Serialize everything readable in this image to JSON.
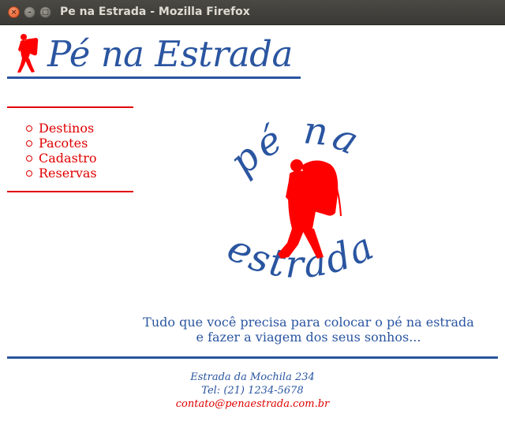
{
  "window": {
    "title": "Pe na Estrada - Mozilla Firefox",
    "close_glyph": "×",
    "minimize_glyph": "–",
    "maximize_glyph": "□"
  },
  "header": {
    "site_title": "Pé na Estrada"
  },
  "nav": {
    "items": [
      {
        "label": "Destinos"
      },
      {
        "label": "Pacotes"
      },
      {
        "label": "Cadastro"
      },
      {
        "label": "Reservas"
      }
    ]
  },
  "logo": {
    "top_text": "pé na",
    "bottom_text": "estrada"
  },
  "tagline": {
    "line1": "Tudo que você precisa para colocar o pé na estrada",
    "line2": "e fazer a viagem dos seus sonhos..."
  },
  "footer": {
    "address": "Estrada da Mochila 234",
    "phone": "Tel: (21) 1234-5678",
    "email": "contato@penaestrada.com.br"
  },
  "colors": {
    "brand_blue": "#2a55a0",
    "accent_red": "#e00000"
  }
}
